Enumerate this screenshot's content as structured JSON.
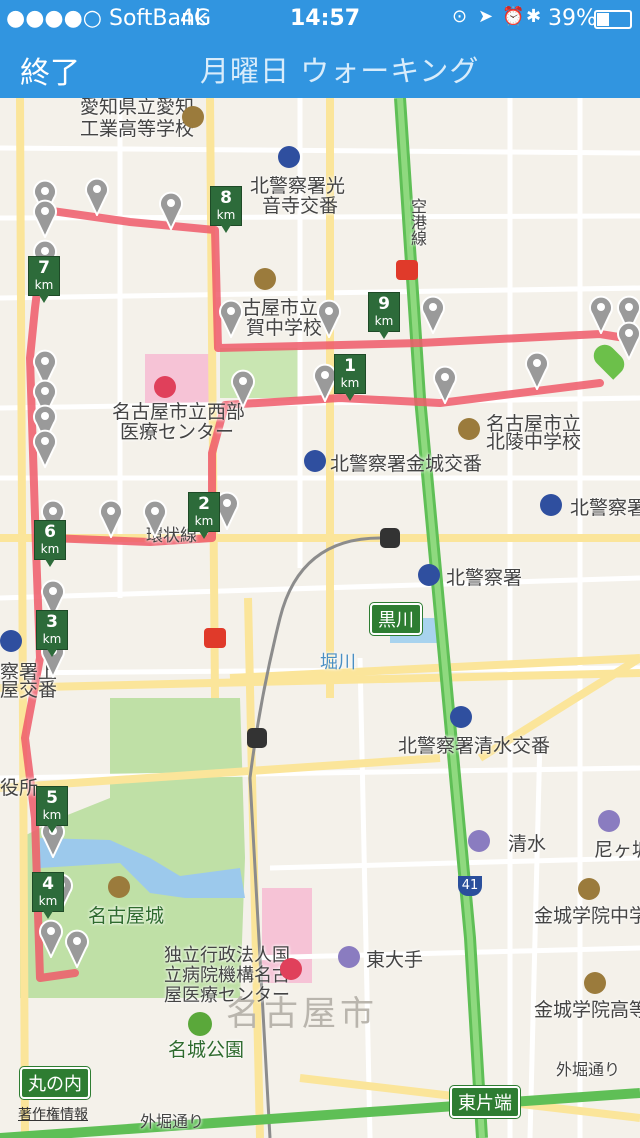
{
  "status": {
    "carrier": "●●●●○ SoftBank",
    "network": "4G",
    "time": "14:57",
    "battery": "39%",
    "icons": [
      "lock-rotation-icon",
      "location-arrow-icon",
      "alarm-icon",
      "bluetooth-icon",
      "battery-icon"
    ]
  },
  "nav": {
    "left_label": "終了",
    "title": "月曜日 ウォーキング"
  },
  "map": {
    "labels": {
      "school1": "愛知県立愛知",
      "school1b": "工業高等学校",
      "police1": "北警察署光",
      "police1b": "音寺交番",
      "road_vert": "空港線",
      "school2": "古屋市立",
      "school2b": "賀中学校",
      "hospital": "名古屋市立西部",
      "hospitalb": "医療センター",
      "school3": "名古屋市立",
      "school3b": "北陵中学校",
      "police2": "北警察署金城交番",
      "police3": "北警察署志",
      "road_ring": "環状線",
      "police4": "北警察署",
      "station_kurokawa": "黒川",
      "river": "堀川",
      "police5": "北警察署清水交番",
      "police6a": "察署上",
      "police6b": "屋交番",
      "office": "役所",
      "shimizu": "清水",
      "amagasaka": "尼ヶ坂",
      "route41": "41",
      "castle": "名古屋城",
      "school4": "金城学院中学校",
      "higashiote": "東大手",
      "hosp2a": "独立行政法人国",
      "hosp2b": "立病院機構名古",
      "hosp2c": "屋医療センター",
      "school5": "金城学院高等学",
      "city": "名古屋市",
      "park": "名城公園",
      "marunouchi": "丸の内",
      "higashikataha": "東片端",
      "sotobori": "外堀通り",
      "sotobori2": "外堀通り",
      "copyright": "著作権情報"
    },
    "km_markers": [
      "1",
      "2",
      "3",
      "4",
      "5",
      "6",
      "7",
      "8",
      "9"
    ],
    "km_unit": "km",
    "colors": {
      "route": "#ef5a6a",
      "marker": "#2d6b3a",
      "main_road": "#63c35a",
      "park": "#bfe0a6"
    }
  }
}
